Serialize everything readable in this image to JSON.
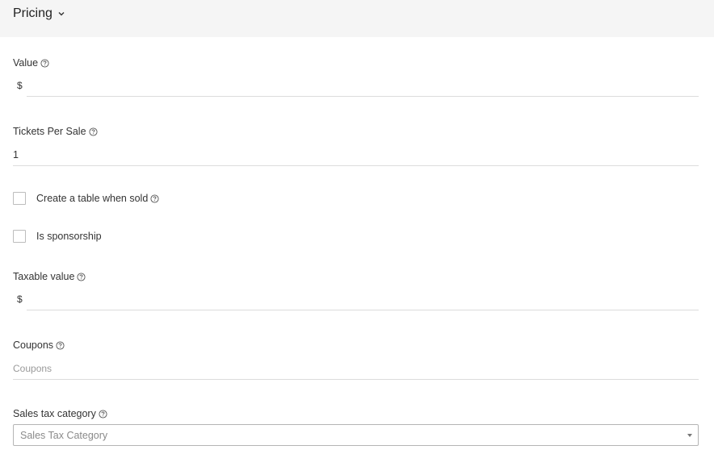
{
  "section": {
    "title": "Pricing"
  },
  "value_field": {
    "label": "Value",
    "prefix": "$",
    "value": ""
  },
  "tickets_field": {
    "label": "Tickets Per Sale",
    "value": "1"
  },
  "create_table": {
    "label": "Create a table when sold",
    "checked": false
  },
  "sponsorship": {
    "label": "Is sponsorship",
    "checked": false
  },
  "taxable_field": {
    "label": "Taxable value",
    "prefix": "$",
    "value": ""
  },
  "coupons_field": {
    "label": "Coupons",
    "placeholder": "Coupons",
    "value": ""
  },
  "sales_tax": {
    "label": "Sales tax category",
    "selected": "Sales Tax Category"
  },
  "icons": {
    "section_toggle": "chevron-down-icon",
    "help": "help-circle-icon",
    "select_arrow": "caret-down-icon"
  },
  "colors": {
    "header_bg": "#f5f5f5",
    "underline": "#dcdcdc",
    "placeholder": "#9a9a9a"
  }
}
